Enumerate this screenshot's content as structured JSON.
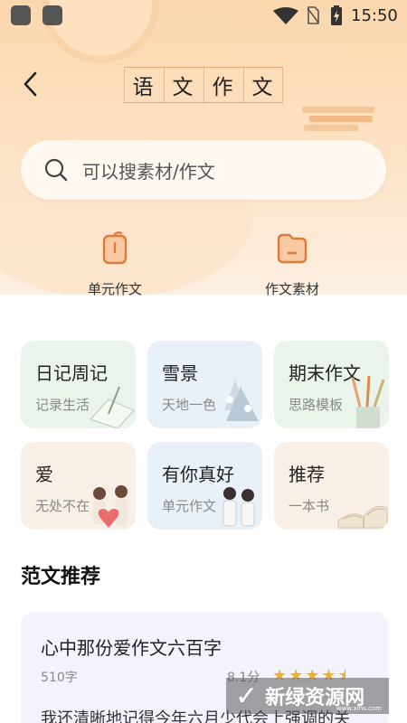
{
  "status_bar": {
    "time": "15:50",
    "icons": [
      "app-icon",
      "app-icon",
      "wifi-icon",
      "no-sim-icon",
      "battery-charging-icon"
    ]
  },
  "header": {
    "title_chars": [
      "语",
      "文",
      "作",
      "文"
    ],
    "back_icon": "chevron-left-icon"
  },
  "search": {
    "placeholder": "可以搜素材/作文",
    "icon": "search-icon"
  },
  "entries": [
    {
      "label": "单元作文",
      "icon": "apple-book-icon"
    },
    {
      "label": "作文素材",
      "icon": "folder-icon"
    }
  ],
  "categories": [
    {
      "title": "日记周记",
      "subtitle": "记录生活",
      "theme": "green"
    },
    {
      "title": "雪景",
      "subtitle": "天地一色",
      "theme": "blue"
    },
    {
      "title": "期末作文",
      "subtitle": "思路模板",
      "theme": "green"
    },
    {
      "title": "爱",
      "subtitle": "无处不在",
      "theme": "beige"
    },
    {
      "title": "有你真好",
      "subtitle": "单元作文",
      "theme": "blue"
    },
    {
      "title": "推荐",
      "subtitle": "一本书",
      "theme": "beige"
    }
  ],
  "section": {
    "title": "范文推荐"
  },
  "recommendation": {
    "title": "心中那份爱作文六百字",
    "word_count": "510字",
    "score": "8.1分",
    "rating": 4.5,
    "excerpt": "我还清晰地记得今年六月少代会上强调的关"
  },
  "watermark": {
    "text": "新绿资源网",
    "url": "www.xlhs.com"
  },
  "colors": {
    "accent": "#e07a3a",
    "star": "#f0b428"
  }
}
